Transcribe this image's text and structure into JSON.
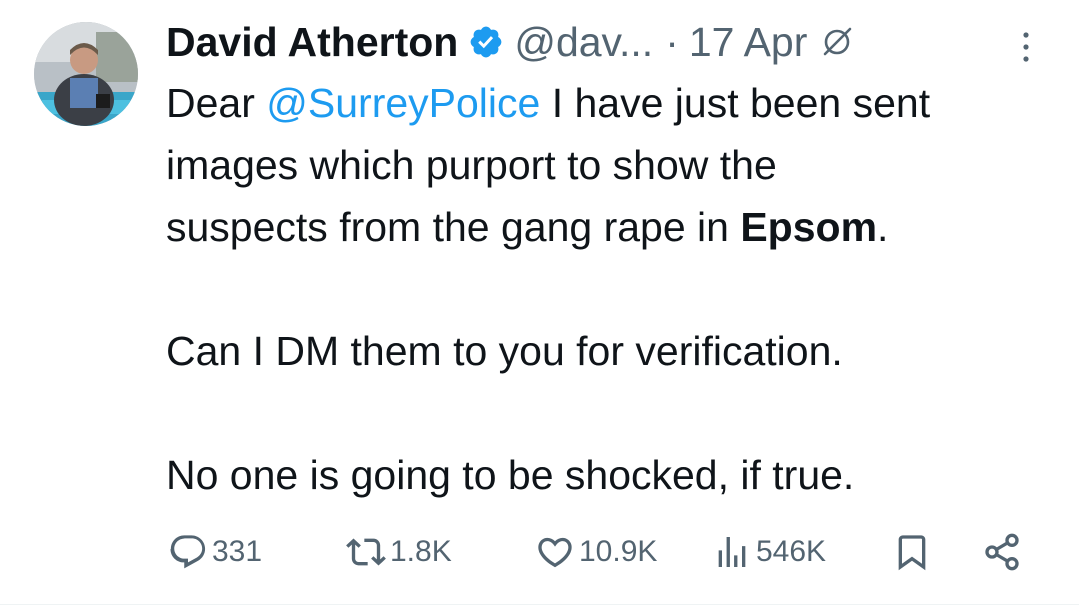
{
  "author": {
    "name": "David Atherton",
    "handle": "@dav...",
    "separator": "·",
    "date": "17 Apr",
    "verified_color": "#1d9bf0",
    "avatar_icon": "profile-photo"
  },
  "tweet": {
    "line1_prefix": "Dear ",
    "mention": "@SurreyPolice",
    "line1_suffix": " I have just been sent",
    "line2": "images which purport to show the",
    "line3_prefix": "suspects from the gang rape in ",
    "line3_bold": "Epsom",
    "line3_suffix": ".",
    "para2": "Can I DM them to you for verification.",
    "para3": "No one is going to be shocked, if true."
  },
  "actions": {
    "replies": "331",
    "reposts": "1.8K",
    "likes": "10.9K",
    "views": "546K"
  },
  "colors": {
    "text": "#0f1419",
    "muted": "#536471",
    "accent": "#1d9bf0"
  },
  "icons": [
    "verified-badge-icon",
    "grok-icon",
    "more-options-icon",
    "reply-icon",
    "repost-icon",
    "like-icon",
    "views-icon",
    "bookmark-icon",
    "share-icon"
  ]
}
